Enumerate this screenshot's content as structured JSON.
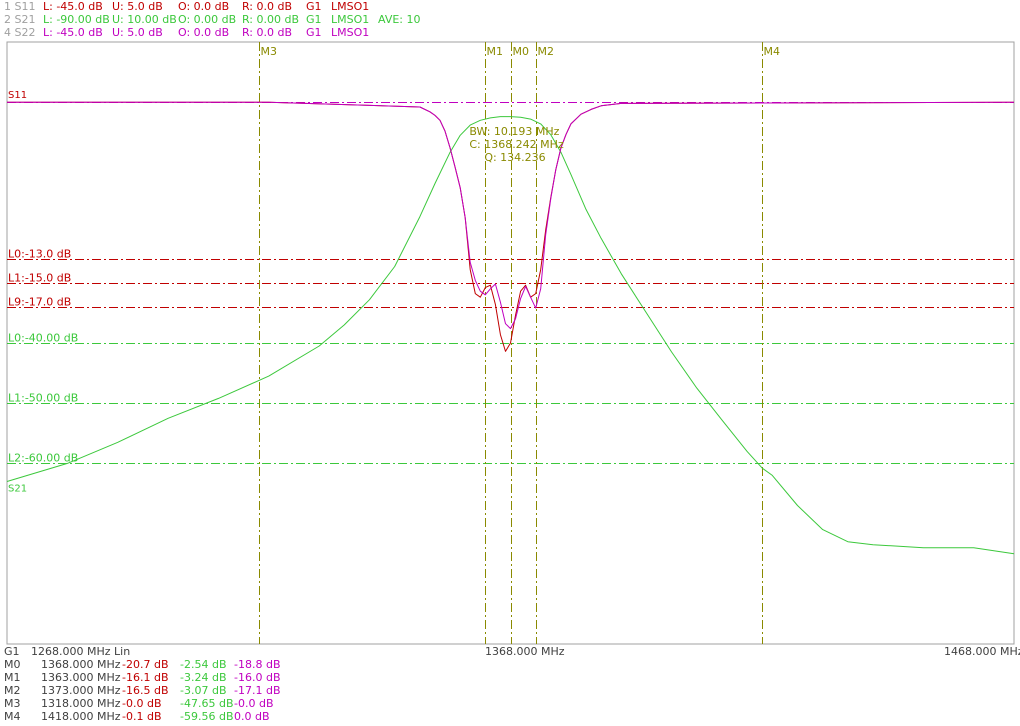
{
  "colors": {
    "s11": "#c00000",
    "s21": "#3cc83c",
    "s22": "#c000c0",
    "marker": "#8a8a00",
    "hdr_id": "#a0a0a0",
    "text": "#404040",
    "frame": "#a0a0a0",
    "bw_text": "#8a8a00"
  },
  "header": [
    {
      "id": "1 S11",
      "l": "L: -45.0 dB",
      "u": "U:  5.0 dB",
      "o": "O:  0.0 dB",
      "r": "R:  0.0 dB",
      "g": "G1",
      "m": "LMSO1",
      "ave": ""
    },
    {
      "id": "2 S21",
      "l": "L: -90.00 dB",
      "u": "U: 10.00 dB",
      "o": "O:  0.00 dB",
      "r": "R:  0.00 dB",
      "g": "G1",
      "m": "LMSO1",
      "ave": "AVE: 10"
    },
    {
      "id": "4 S22",
      "l": "L: -45.0 dB",
      "u": "U:  5.0 dB",
      "o": "O:  0.0 dB",
      "r": "R:  0.0 dB",
      "g": "G1",
      "m": "LMSO1",
      "ave": ""
    }
  ],
  "chart_data": {
    "type": "line",
    "x_unit": "MHz",
    "xlim": [
      1268,
      1468
    ],
    "x_ticks": [
      "1268.000 MHz Lin",
      "1368.000 MHz",
      "1468.000 MHz"
    ],
    "group_label": "G1",
    "series": [
      {
        "name": "S11",
        "ylim": [
          -45,
          5
        ],
        "x": [
          1268,
          1320,
          1350,
          1352,
          1353,
          1354,
          1355,
          1356,
          1357,
          1358,
          1359,
          1360,
          1361,
          1362,
          1363,
          1364,
          1365,
          1366,
          1367,
          1368,
          1369,
          1370,
          1371,
          1372,
          1373,
          1374,
          1375,
          1376,
          1377,
          1378,
          1379,
          1380,
          1382,
          1384,
          1386,
          1390,
          1468
        ],
        "y": [
          0,
          0,
          -0.4,
          -0.8,
          -1.1,
          -1.5,
          -2.4,
          -3.8,
          -5.4,
          -7.1,
          -9.6,
          -13.9,
          -15.9,
          -16.2,
          -15.4,
          -15.2,
          -16.8,
          -19.3,
          -20.7,
          -20.0,
          -17.7,
          -15.7,
          -15.2,
          -16.2,
          -15.9,
          -13.9,
          -10.6,
          -7.9,
          -5.6,
          -3.8,
          -2.7,
          -1.8,
          -1.0,
          -0.6,
          -0.3,
          -0.1,
          0
        ]
      },
      {
        "name": "S21",
        "ylim": [
          -90,
          10
        ],
        "x": [
          1268,
          1280,
          1290,
          1300,
          1310,
          1320,
          1330,
          1335,
          1340,
          1345,
          1350,
          1353,
          1356,
          1358,
          1360,
          1362,
          1364,
          1366,
          1368,
          1370,
          1372,
          1374,
          1376,
          1378,
          1380,
          1383,
          1386,
          1390,
          1395,
          1400,
          1405,
          1410,
          1415,
          1418,
          1420,
          1425,
          1430,
          1435,
          1440,
          1450,
          1460,
          1468
        ],
        "y": [
          -63,
          -60,
          -56.5,
          -52.5,
          -49.2,
          -45.5,
          -40.5,
          -37,
          -32.8,
          -27.3,
          -19,
          -13.5,
          -8.3,
          -5.5,
          -3.8,
          -3,
          -2.6,
          -2.4,
          -2.4,
          -2.5,
          -2.8,
          -3.6,
          -5.4,
          -8.3,
          -12,
          -17.8,
          -22.6,
          -28.5,
          -35,
          -41.5,
          -47.5,
          -52.8,
          -58,
          -60.8,
          -62,
          -67,
          -71,
          -73,
          -73.5,
          -74,
          -74,
          -75
        ]
      },
      {
        "name": "S22",
        "ylim": [
          -45,
          5
        ],
        "x": [
          1268,
          1320,
          1350,
          1352,
          1353,
          1354,
          1355,
          1356,
          1357,
          1358,
          1359,
          1360,
          1361,
          1362,
          1363,
          1364,
          1365,
          1366,
          1367,
          1368,
          1369,
          1370,
          1371,
          1372,
          1373,
          1374,
          1375,
          1376,
          1377,
          1378,
          1379,
          1380,
          1382,
          1384,
          1386,
          1390,
          1468
        ],
        "y": [
          0,
          0,
          -0.4,
          -0.8,
          -1.1,
          -1.5,
          -2.4,
          -3.8,
          -5.4,
          -7.1,
          -9.6,
          -13.3,
          -14.8,
          -15.7,
          -16.0,
          -15.5,
          -15.1,
          -16.6,
          -18.4,
          -18.8,
          -18.0,
          -16.3,
          -15.3,
          -16.2,
          -17.1,
          -15.5,
          -11.0,
          -8.0,
          -5.6,
          -3.8,
          -2.7,
          -1.8,
          -1.0,
          -0.6,
          -0.3,
          -0.1,
          0
        ]
      }
    ],
    "trace_labels": [
      "S11",
      "S21"
    ],
    "limit_lines": [
      {
        "label": "L0:-13.0 dB",
        "value": -13.0,
        "series": "S11"
      },
      {
        "label": "L1:-15.0 dB",
        "value": -15.0,
        "series": "S11"
      },
      {
        "label": "L9:-17.0 dB",
        "value": -17.0,
        "series": "S11"
      },
      {
        "label": "L0:-40.00 dB",
        "value": -40.0,
        "series": "S21"
      },
      {
        "label": "L1:-50.00 dB",
        "value": -50.0,
        "series": "S21"
      },
      {
        "label": "L2:-60.00 dB",
        "value": -60.0,
        "series": "S21"
      }
    ],
    "reference_line": {
      "value": 0,
      "series": "S22"
    },
    "markers": [
      {
        "name": "M0",
        "freq": "1368.000 MHz",
        "x": 1368,
        "s11": "-20.7 dB",
        "s21": "-2.54 dB",
        "s22": "-18.8 dB"
      },
      {
        "name": "M1",
        "freq": "1363.000 MHz",
        "x": 1363,
        "s11": "-16.1 dB",
        "s21": "-3.24 dB",
        "s22": "-16.0 dB"
      },
      {
        "name": "M2",
        "freq": "1373.000 MHz",
        "x": 1373,
        "s11": "-16.5 dB",
        "s21": "-3.07 dB",
        "s22": "-17.1 dB"
      },
      {
        "name": "M3",
        "freq": "1318.000 MHz",
        "x": 1318,
        "s11": "-0.0 dB",
        "s21": "-47.65 dB",
        "s22": "-0.0 dB"
      },
      {
        "name": "M4",
        "freq": "1418.000 MHz",
        "x": 1418,
        "s11": "-0.1 dB",
        "s21": "-59.56 dB",
        "s22": "0.0 dB"
      }
    ],
    "bandwidth_readout": {
      "bw": "BW:  10.193 MHz",
      "center": "C:  1368.242 MHz",
      "q": "Q:  134.236"
    }
  }
}
